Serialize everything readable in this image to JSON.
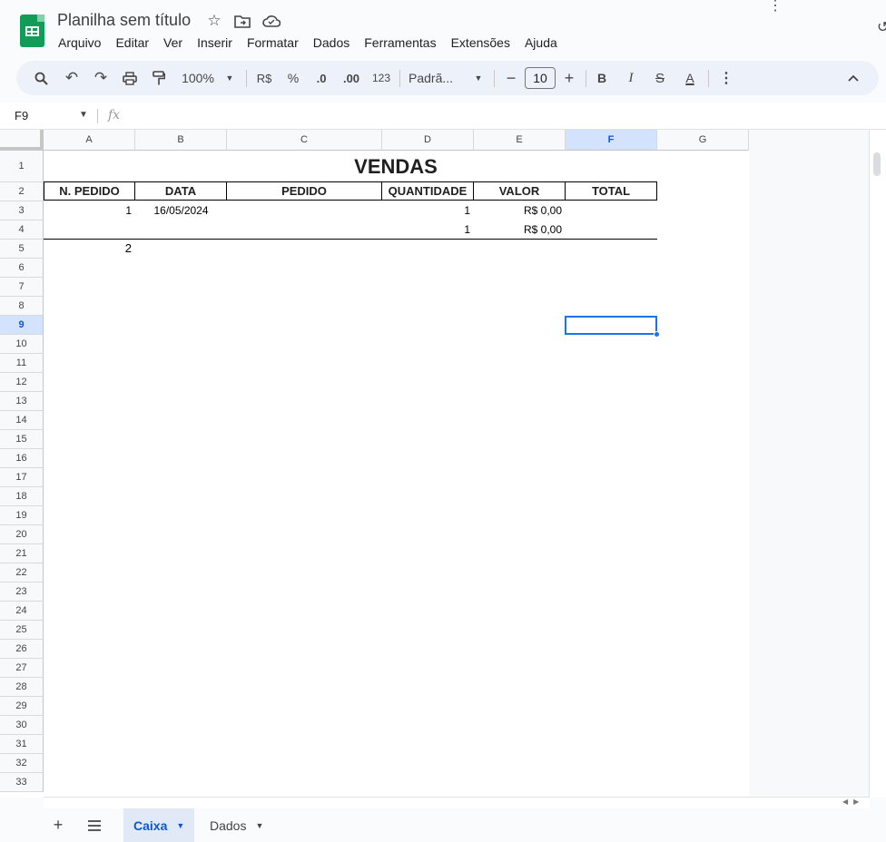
{
  "header": {
    "title": "Planilha sem título",
    "menu": [
      "Arquivo",
      "Editar",
      "Ver",
      "Inserir",
      "Formatar",
      "Dados",
      "Ferramentas",
      "Extensões",
      "Ajuda"
    ]
  },
  "toolbar": {
    "zoom": "100%",
    "currency": "R$",
    "percent": "%",
    "dec_decrease": ".0",
    "dec_increase": ".00",
    "number_format": "123",
    "font": "Padrã...",
    "font_size": "10",
    "bold": "B",
    "italic": "I",
    "text_color": "A"
  },
  "formula_bar": {
    "cell_ref": "F9",
    "fx": "fx",
    "value": ""
  },
  "grid": {
    "columns": [
      "A",
      "B",
      "C",
      "D",
      "E",
      "F",
      "G"
    ],
    "selected_column": "F",
    "rows": [
      "1",
      "2",
      "3",
      "4",
      "5",
      "6",
      "7",
      "8",
      "9",
      "10",
      "11",
      "12",
      "13",
      "14",
      "15",
      "16",
      "17",
      "18",
      "19",
      "20",
      "21",
      "22",
      "23",
      "24",
      "25",
      "26",
      "27",
      "28",
      "29",
      "30",
      "31",
      "32",
      "33"
    ],
    "selected_row": "9",
    "title": "VENDAS",
    "table_headers": [
      "N. PEDIDO",
      "DATA",
      "PEDIDO",
      "QUANTIDADE",
      "VALOR",
      "TOTAL"
    ],
    "row3": {
      "a": "1",
      "b": "16/05/2024",
      "d": "1",
      "e": "R$ 0,00"
    },
    "row4": {
      "d": "1",
      "e": "R$ 0,00"
    },
    "row5": {
      "a": "2"
    },
    "selected_cell": "F9"
  },
  "sheets": {
    "tabs": [
      {
        "label": "Caixa",
        "active": true
      },
      {
        "label": "Dados",
        "active": false
      }
    ]
  },
  "colors": {
    "accent": "#0b57d0",
    "selection": "#1a73e8",
    "sheets_green": "#0f9d58"
  }
}
